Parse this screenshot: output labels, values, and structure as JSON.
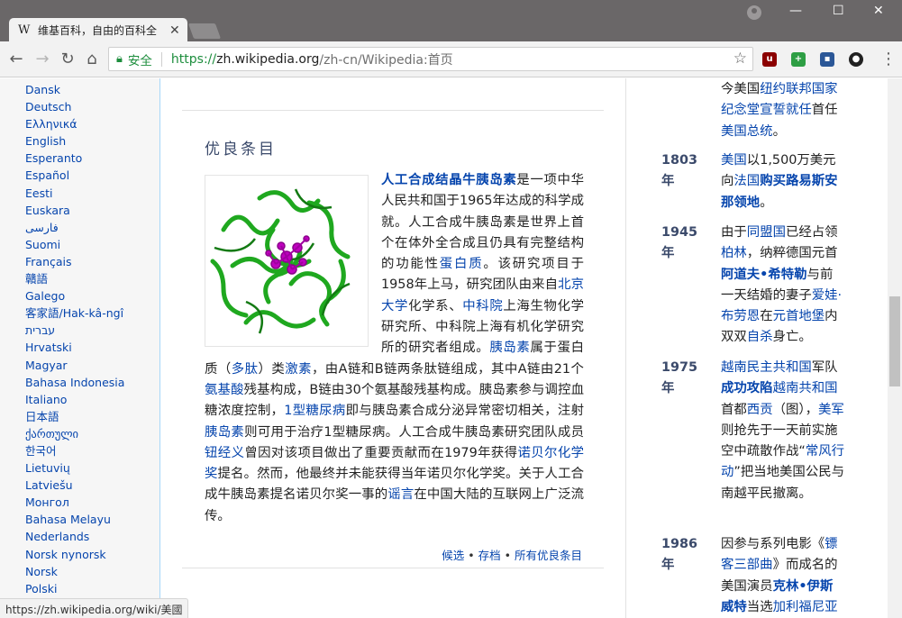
{
  "browser": {
    "tab_title": "维基百科，自由的百科全",
    "tab_favicon": "W",
    "secure_label": "安全",
    "url_scheme": "https://",
    "url_host": "zh.wikipedia.org",
    "url_path": "/zh-cn/Wikipedia:首页",
    "status_url": "https://zh.wikipedia.org/wiki/美國"
  },
  "sidebar": {
    "languages": [
      "Dansk",
      "Deutsch",
      "Ελληνικά",
      "English",
      "Esperanto",
      "Español",
      "Eesti",
      "Euskara",
      "فارسی",
      "Suomi",
      "Français",
      "贛語",
      "Galego",
      "客家語/Hak-kâ-ngî",
      "עברית",
      "Hrvatski",
      "Magyar",
      "Bahasa Indonesia",
      "Italiano",
      "日本語",
      "ქართული",
      "한국어",
      "Lietuvių",
      "Latviešu",
      "Монгол",
      "Bahasa Melayu",
      "Nederlands",
      "Norsk nynorsk",
      "Norsk",
      "Polski"
    ]
  },
  "featured": {
    "section_title": "优良条目",
    "image_name": "insulin-molecule-image",
    "t1": "人工合成结晶牛胰岛素",
    "t2": "是一项中华人民共和国于1965年达成的科学成就。人工合成牛胰岛素是世界上首个在体外全合成且仍具有完整结构的功能性",
    "t3": "蛋白质",
    "t4": "。该研究项目于1958年上马，研究团队由来自",
    "t5": "北京大学",
    "t6": "化学系、",
    "t7": "中科院",
    "t8": "上海生物化学研究所、中科院上海有机化学研究所的研究者组成。",
    "t9": "胰岛素",
    "t10": "属于蛋白质（",
    "t11": "多肽",
    "t12": "）类",
    "t13": "激素",
    "t14": "，由A链和B链两条肽链组成，其中A链由21个",
    "t15": "氨基酸",
    "t16": "残基构成，B链由30个氨基酸残基构成。胰岛素参与调控血糖浓度控制，",
    "t17": "1型糖尿病",
    "t18": "即与胰岛素合成分泌异常密切相关，注射",
    "t19": "胰岛素",
    "t20": "则可用于治疗1型糖尿病。人工合成牛胰岛素研究团队成员",
    "t21": "钮经义",
    "t22": "曾因对该项目做出了重要贡献而在1979年获得",
    "t23": "诺贝尔化学奖",
    "t24": "提名。然而，他最终并未能获得当年诺贝尔化学奖。关于人工合成牛胰岛素提名诺贝尔奖一事的",
    "t25": "谣言",
    "t26": "在中国大陆的互联网上广泛流传。",
    "link_candidates": "候选",
    "link_archive": "存档",
    "link_all": "所有优良条目",
    "separator": "•"
  },
  "onthisday": {
    "e0": {
      "a": "今美国",
      "b": "纽约联邦国家纪念堂宣誓就任",
      "c": "首任",
      "d": "美国总统",
      "e": "。"
    },
    "e1": {
      "year": "1803年",
      "a": "美国",
      "b": "以1,500万美元向",
      "c": "法国",
      "d": "购买路易斯安那领地",
      "e": "。"
    },
    "e2": {
      "year": "1945年",
      "a": "由于",
      "b": "同盟国",
      "c": "已经占领",
      "d": "柏林",
      "e": "，纳粹德国元首",
      "f": "阿道夫•希特勒",
      "g": "与前一天结婚的妻子",
      "h": "爱娃·布劳恩",
      "i": "在",
      "j": "元首地堡",
      "k": "内双双",
      "l": "自杀",
      "m": "身亡。"
    },
    "e3": {
      "year": "1975年",
      "a": "越南民主共和国",
      "b": "军队",
      "c": "成功攻陷",
      "d": "越南共和国",
      "e": "首都",
      "f": "西贡",
      "g": "（图），",
      "h": "美军",
      "i": "则抢先于一天前实施空中疏散作战“",
      "j": "常风行动",
      "k": "”把当地美国公民与南越平民撤离。"
    },
    "e4": {
      "year": "1986年",
      "a": "因参与系列电影《",
      "b": "镖客三部曲",
      "c": "》而成名的美国演员",
      "d": "克林•伊斯威特",
      "e": "当选",
      "f": "加利福尼亚"
    }
  }
}
